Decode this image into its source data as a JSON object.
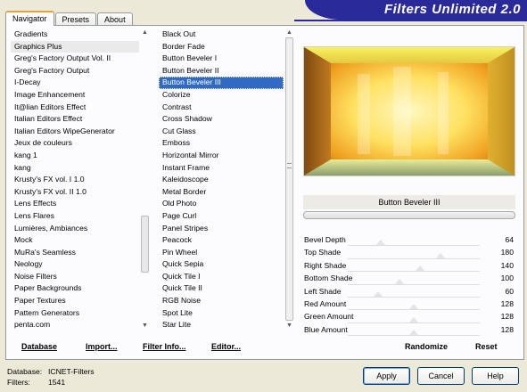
{
  "tabs": [
    "Navigator",
    "Presets",
    "About"
  ],
  "banner_title": "Filters Unlimited 2.0",
  "categories": [
    "Gradients",
    "Graphics Plus",
    "Greg's Factory Output Vol. II",
    "Greg's Factory Output",
    "I-Decay",
    "Image Enhancement",
    "It@lian Editors Effect",
    "Italian Editors Effect",
    "Italian Editors WipeGenerator",
    "Jeux de couleurs",
    "kang 1",
    "kang",
    "Krusty's FX vol. I 1.0",
    "Krusty's FX vol. II 1.0",
    "Lens Effects",
    "Lens Flares",
    "Lumières, Ambiances",
    "Mock",
    "MuRa's Seamless",
    "Neology",
    "Noise Filters",
    "Paper Backgrounds",
    "Paper Textures",
    "Pattern Generators",
    "penta.com"
  ],
  "filters": [
    "Black Out",
    "Border Fade",
    "Button Beveler I",
    "Button Beveler II",
    "Button Beveler III",
    "Colorize",
    "Contrast",
    "Cross Shadow",
    "Cut Glass",
    "Emboss",
    "Horizontal Mirror",
    "Instant Frame",
    "Kaleidoscope",
    "Metal Border",
    "Old Photo",
    "Page Curl",
    "Panel Stripes",
    "Peacock",
    "Pin Wheel",
    "Quick Sepia",
    "Quick Tile I",
    "Quick Tile II",
    "RGB Noise",
    "Spot Lite",
    "Star Lite"
  ],
  "selected_filter": "Button Beveler III",
  "sliders": [
    {
      "label": "Bevel Depth",
      "value": "64",
      "level": 0.25
    },
    {
      "label": "Top Shade",
      "value": "180",
      "level": 0.7
    },
    {
      "label": "Right Shade",
      "value": "140",
      "level": 0.55
    },
    {
      "label": "Bottom Shade",
      "value": "100",
      "level": 0.39
    },
    {
      "label": "Left Shade",
      "value": "60",
      "level": 0.23
    },
    {
      "label": "Red Amount",
      "value": "128",
      "level": 0.5
    },
    {
      "label": "Green Amount",
      "value": "128",
      "level": 0.5
    },
    {
      "label": "Blue Amount",
      "value": "128",
      "level": 0.5
    }
  ],
  "links": {
    "database": "Database",
    "import": "Import...",
    "filter_info": "Filter Info...",
    "editor": "Editor...",
    "randomize": "Randomize",
    "reset": "Reset"
  },
  "status": {
    "database_label": "Database:",
    "database_value": "ICNET-Filters",
    "filters_label": "Filters:",
    "filters_value": "1541"
  },
  "buttons": {
    "apply": "Apply",
    "cancel": "Cancel",
    "help": "Help"
  },
  "colors": {
    "selection": "#316ac5",
    "banner": "#2a2a9a"
  }
}
